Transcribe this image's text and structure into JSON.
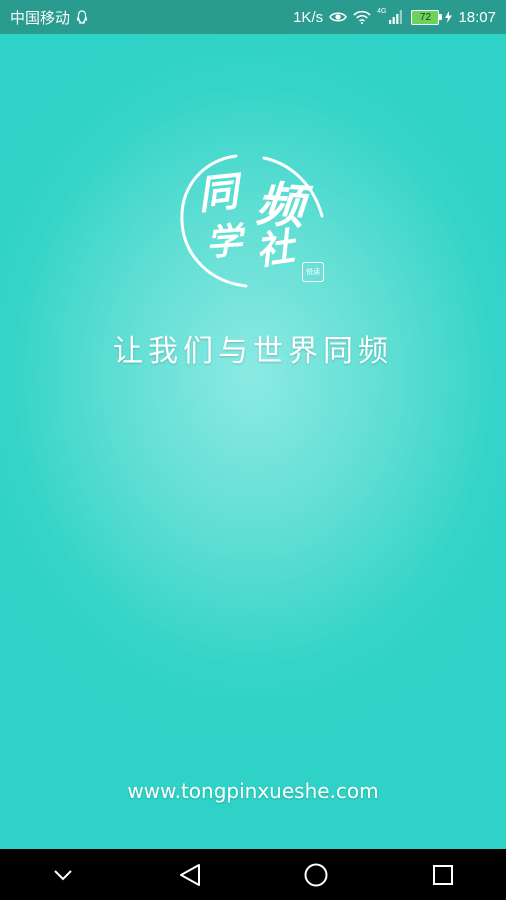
{
  "status_bar": {
    "carrier": "中国移动",
    "speed": "1K/s",
    "network": "4G",
    "battery": "72",
    "time": "18:07"
  },
  "splash": {
    "logo_chars": [
      "同",
      "频",
      "学",
      "社"
    ],
    "seal_text": "悦读",
    "slogan": "让我们与世界同频",
    "website": "www.tongpinxueshe.com"
  },
  "colors": {
    "status_bar_bg": "#2a9c8f",
    "splash_bg": "#2fd6c9",
    "nav_bar_bg": "#000000"
  }
}
